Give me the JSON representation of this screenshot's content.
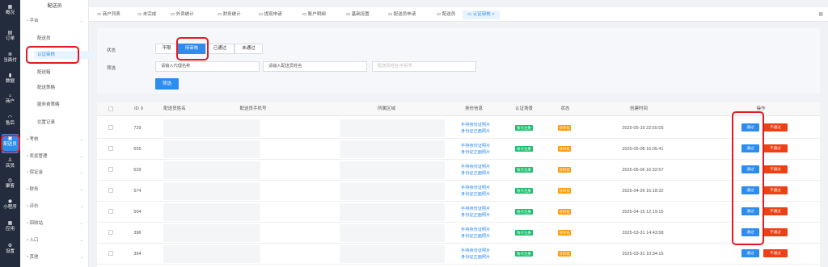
{
  "rail": {
    "items": [
      {
        "label": "概况",
        "icon": "grid-icon"
      },
      {
        "label": "订单",
        "icon": "document-icon"
      },
      {
        "label": "当面付",
        "icon": "list-icon"
      },
      {
        "label": "数据",
        "icon": "bar-chart-icon"
      },
      {
        "label": "商户",
        "icon": "store-icon"
      },
      {
        "label": "售后",
        "icon": "headset-icon"
      },
      {
        "label": "配送员",
        "icon": "courier-icon"
      },
      {
        "label": "店员",
        "icon": "user-icon"
      },
      {
        "label": "聚客",
        "icon": "gift-icon"
      },
      {
        "label": "小程序",
        "icon": "chat-icon"
      },
      {
        "label": "应用",
        "icon": "apps-icon"
      },
      {
        "label": "设置",
        "icon": "gear-icon"
      }
    ]
  },
  "submenu": {
    "title": "配送员",
    "groups": [
      {
        "label": "平台"
      },
      {
        "label": "配送员"
      },
      {
        "label": "认证审核"
      },
      {
        "label": "配送箱"
      },
      {
        "label": "配送策略"
      },
      {
        "label": "服务费策略"
      },
      {
        "label": "位置记录"
      },
      {
        "label": "考核"
      },
      {
        "label": "奖惩管理"
      },
      {
        "label": "保证金"
      },
      {
        "label": "财务"
      },
      {
        "label": "评价"
      },
      {
        "label": "回收站"
      },
      {
        "label": "入口"
      },
      {
        "label": "其他"
      }
    ]
  },
  "tabs": [
    "商户列表",
    "未完成",
    "外卖统计",
    "财务统计",
    "提现申请",
    "账户明细",
    "基础设置",
    "配送员申请",
    "配送员",
    "认证审核"
  ],
  "filters": {
    "status_label": "状态",
    "status_options": [
      "不限",
      "待审核",
      "已通过",
      "未通过"
    ],
    "search_label": "筛选",
    "agent_placeholder": "请输入代理名称",
    "courier_placeholder": "请输入配送员姓名",
    "phone_placeholder": "配送员姓名/手机号",
    "submit_label": "筛选"
  },
  "table": {
    "headers": [
      "ID",
      "配送员姓名",
      "配送员手机号",
      "所属区域",
      "身份信息",
      "认证场景",
      "状态",
      "创建时间",
      "操作"
    ],
    "rows": [
      {
        "id": "729",
        "id_link1": "手持身份证照片",
        "id_link2": "身份证正面照片",
        "scene": "账号注册",
        "status": "待审核",
        "created": "2025-05-19 22:55:05"
      },
      {
        "id": "655",
        "id_link1": "手持身份证照片",
        "id_link2": "身份证正面照片",
        "scene": "账号注册",
        "status": "待审核",
        "created": "2025-05-08 16:05:41"
      },
      {
        "id": "629",
        "id_link1": "手持身份证照片",
        "id_link2": "身份证正面照片",
        "scene": "账号注册",
        "status": "待审核",
        "created": "2025-05-06 16:32:57"
      },
      {
        "id": "574",
        "id_link1": "手持身份证照片",
        "id_link2": "身份证正面照片",
        "scene": "账号注册",
        "status": "待审核",
        "created": "2025-04-26 16:18:32"
      },
      {
        "id": "504",
        "id_link1": "手持身份证照片",
        "id_link2": "身份证正面照片",
        "scene": "账号注册",
        "status": "待审核",
        "created": "2025-04-15 12:19:15"
      },
      {
        "id": "396",
        "id_link1": "手持身份证照片",
        "id_link2": "身份证正面照片",
        "scene": "账号注册",
        "status": "待审核",
        "created": "2025-03-31 14:43:58"
      },
      {
        "id": "394",
        "id_link1": "手持身份证照片",
        "id_link2": "身份证正面照片",
        "scene": "账号注册",
        "status": "待审核",
        "created": "2025-03-31 10:34:15"
      }
    ],
    "pass_label": "通过",
    "reject_label": "不通过"
  },
  "colors": {
    "accent": "#2d8cf0",
    "danger": "#ed4014",
    "success": "#19be6b",
    "warning": "#ff9900",
    "highlight": "#e01b24",
    "sidebar": "#222c3c"
  }
}
